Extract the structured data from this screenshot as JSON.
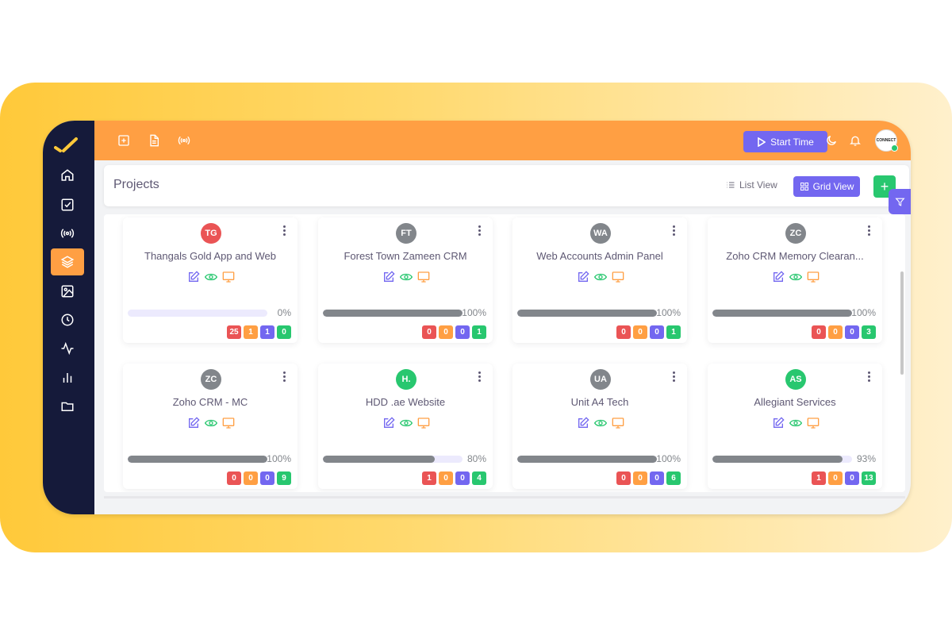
{
  "colors": {
    "accent": "#7367f0",
    "topbar": "#ff9f43",
    "sidebar": "#151a3a",
    "success": "#28c76f",
    "danger": "#ea5455",
    "warning": "#ff9f43",
    "progress": "#82868b"
  },
  "sidebar": {
    "items": [
      {
        "name": "home-icon",
        "active": false
      },
      {
        "name": "checkbox-icon",
        "active": false
      },
      {
        "name": "broadcast-icon",
        "active": false
      },
      {
        "name": "layers-icon",
        "active": true
      },
      {
        "name": "image-icon",
        "active": false
      },
      {
        "name": "clock-icon",
        "active": false
      },
      {
        "name": "activity-icon",
        "active": false
      },
      {
        "name": "bar-chart-icon",
        "active": false
      },
      {
        "name": "folder-icon",
        "active": false
      }
    ]
  },
  "topbar": {
    "icons": [
      "plus-square-icon",
      "file-text-icon",
      "broadcast-icon"
    ],
    "start_time_label": "Start Time",
    "user_avatar_text": "CONNECT"
  },
  "header": {
    "title": "Projects",
    "list_view_label": "List View",
    "grid_view_label": "Grid View",
    "add_label": "+"
  },
  "projects": [
    {
      "initials": "TG",
      "avatar_color": "#ea5455",
      "name": "Thangals Gold App and Web",
      "progress": 0,
      "progress_label": "0%",
      "counts": [
        "25",
        "1",
        "1",
        "0"
      ]
    },
    {
      "initials": "FT",
      "avatar_color": "#82868b",
      "name": "Forest Town Zameen CRM",
      "progress": 100,
      "progress_label": "100%",
      "counts": [
        "0",
        "0",
        "0",
        "1"
      ]
    },
    {
      "initials": "WA",
      "avatar_color": "#82868b",
      "name": "Web Accounts Admin Panel",
      "progress": 100,
      "progress_label": "100%",
      "counts": [
        "0",
        "0",
        "0",
        "1"
      ]
    },
    {
      "initials": "ZC",
      "avatar_color": "#82868b",
      "name": "Zoho CRM Memory Clearan...",
      "progress": 100,
      "progress_label": "100%",
      "counts": [
        "0",
        "0",
        "0",
        "3"
      ]
    },
    {
      "initials": "ZC",
      "avatar_color": "#82868b",
      "name": "Zoho CRM - MC",
      "progress": 100,
      "progress_label": "100%",
      "counts": [
        "0",
        "0",
        "0",
        "9"
      ]
    },
    {
      "initials": "H.",
      "avatar_color": "#28c76f",
      "name": "HDD .ae Website",
      "progress": 80,
      "progress_label": "80%",
      "counts": [
        "1",
        "0",
        "0",
        "4"
      ]
    },
    {
      "initials": "UA",
      "avatar_color": "#82868b",
      "name": "Unit A4 Tech",
      "progress": 100,
      "progress_label": "100%",
      "counts": [
        "0",
        "0",
        "0",
        "6"
      ]
    },
    {
      "initials": "AS",
      "avatar_color": "#28c76f",
      "name": "Allegiant Services",
      "progress": 93,
      "progress_label": "93%",
      "counts": [
        "1",
        "0",
        "0",
        "13"
      ]
    }
  ]
}
